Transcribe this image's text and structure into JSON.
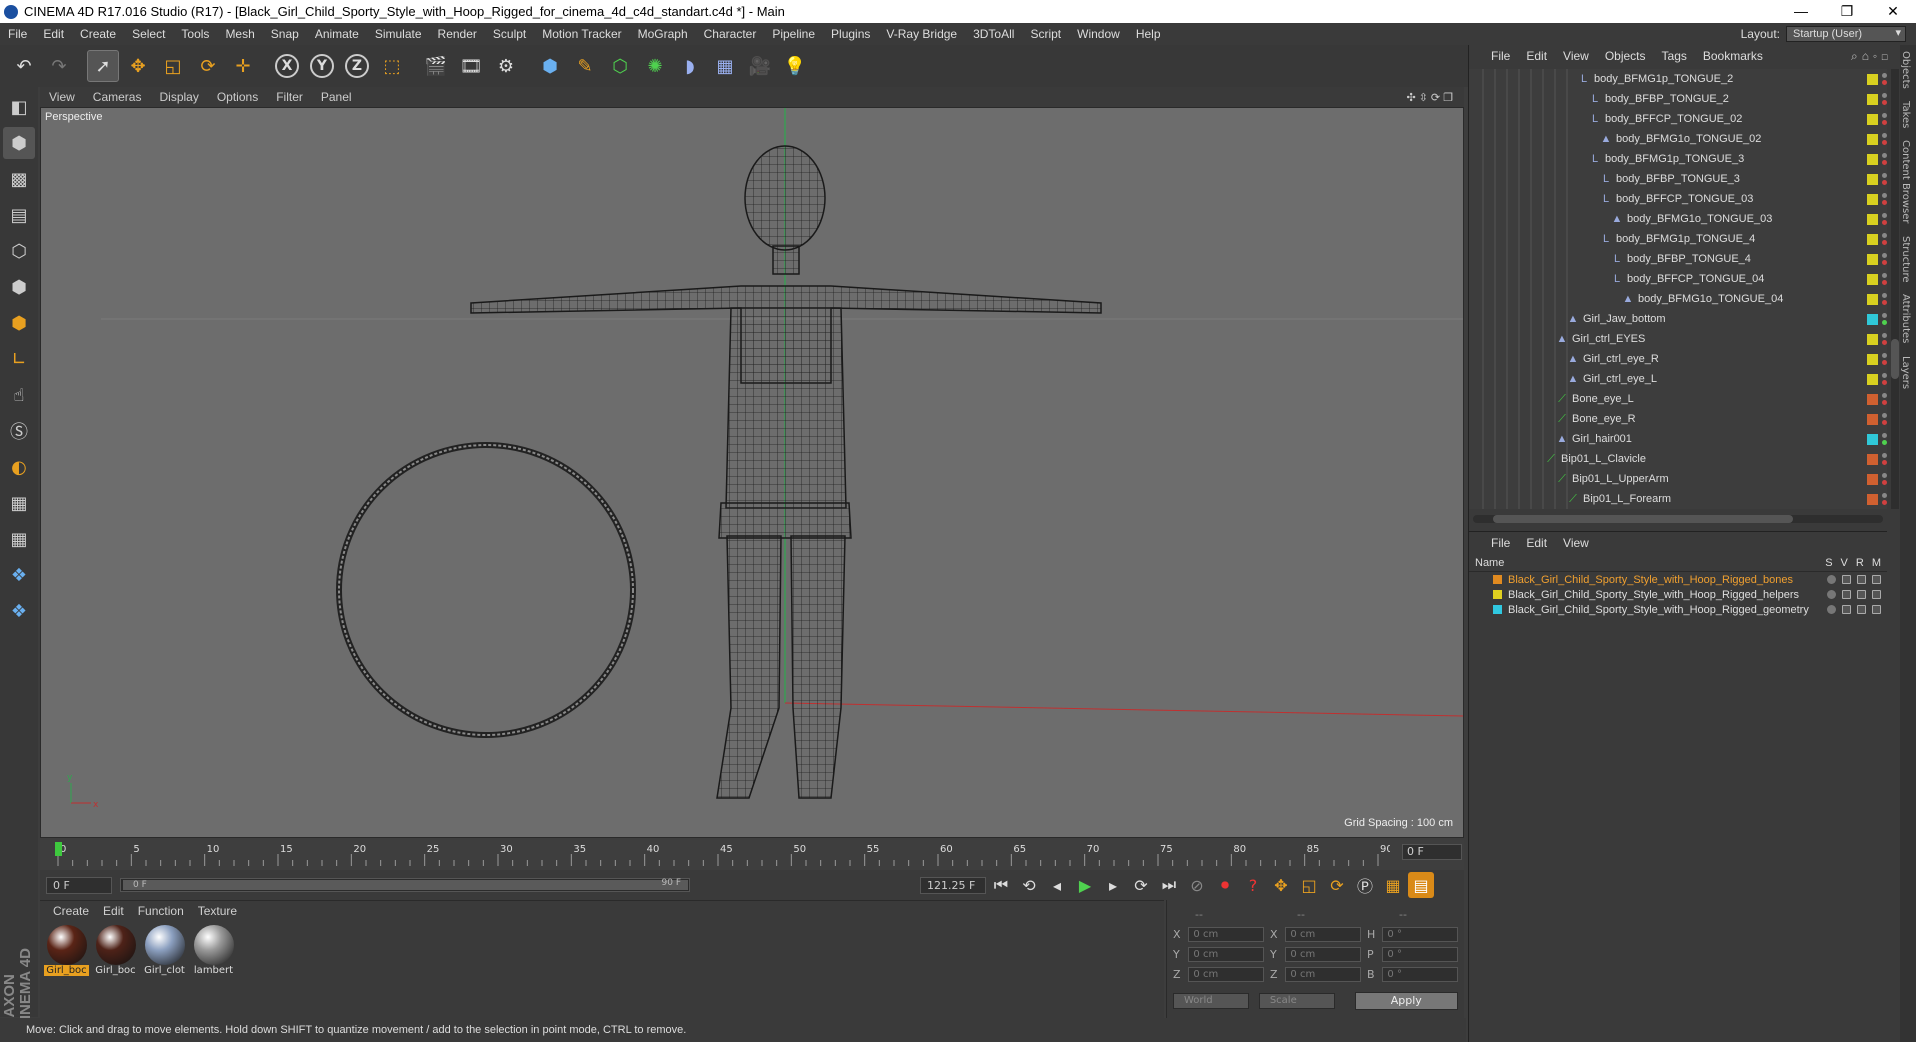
{
  "window": {
    "title": "CINEMA 4D R17.016 Studio (R17) - [Black_Girl_Child_Sporty_Style_with_Hoop_Rigged_for_cinema_4d_c4d_standart.c4d *] - Main",
    "min": "—",
    "restore": "❐",
    "close": "✕"
  },
  "menubar": {
    "items": [
      "File",
      "Edit",
      "Create",
      "Select",
      "Tools",
      "Mesh",
      "Snap",
      "Animate",
      "Simulate",
      "Render",
      "Sculpt",
      "Motion Tracker",
      "MoGraph",
      "Character",
      "Pipeline",
      "Plugins",
      "V-Ray Bridge",
      "3DToAll",
      "Script",
      "Window",
      "Help"
    ],
    "layout_label": "Layout:",
    "layout_value": "Startup (User)"
  },
  "toolbar": {
    "axis_x": "X",
    "axis_y": "Y",
    "axis_z": "Z"
  },
  "viewport": {
    "menu": [
      "View",
      "Cameras",
      "Display",
      "Options",
      "Filter",
      "Panel"
    ],
    "nav_icons": "✣⇳⟳❐",
    "label": "Perspective",
    "grid_spacing": "Grid Spacing : 100 cm",
    "axis_x": "x",
    "axis_y": "y"
  },
  "timeline": {
    "ticks": [
      "0",
      "5",
      "10",
      "15",
      "20",
      "25",
      "30",
      "35",
      "40",
      "45",
      "50",
      "55",
      "60",
      "65",
      "70",
      "75",
      "80",
      "85",
      "90"
    ],
    "current_frame": "0 F"
  },
  "transport": {
    "start_field": "0 F",
    "range_start": "0 F",
    "range_end": "90 F",
    "end_field": "121.25 F"
  },
  "materials": {
    "menu": [
      "Create",
      "Edit",
      "Function",
      "Texture"
    ],
    "items": [
      {
        "label": "Girl_boc",
        "color": "#5a2416"
      },
      {
        "label": "Girl_boc",
        "color": "#4e2218"
      },
      {
        "label": "Girl_clot",
        "color": "#8ca0c0"
      },
      {
        "label": "lambert",
        "color": "#9a9a9a"
      }
    ]
  },
  "coords": {
    "header": [
      "--",
      "--",
      "--"
    ],
    "rows": [
      {
        "a": "X",
        "av": "0 cm",
        "b": "X",
        "bv": "0 cm",
        "c": "H",
        "cv": "0 °"
      },
      {
        "a": "Y",
        "av": "0 cm",
        "b": "Y",
        "bv": "0 cm",
        "c": "P",
        "cv": "0 °"
      },
      {
        "a": "Z",
        "av": "0 cm",
        "b": "Z",
        "bv": "0 cm",
        "c": "B",
        "cv": "0 °"
      }
    ],
    "world": "World",
    "scale": "Scale",
    "apply": "Apply"
  },
  "status": {
    "text": "Move: Click and drag to move elements. Hold down SHIFT to quantize movement / add to the selection in point mode, CTRL to remove."
  },
  "objects": {
    "menu": [
      "File",
      "Edit",
      "View",
      "Objects",
      "Tags",
      "Bookmarks"
    ],
    "rows": [
      {
        "name": "body_BFMG1p_TONGUE_2",
        "depth": 9,
        "icon": "null",
        "color": "#d8d020"
      },
      {
        "name": "body_BFBP_TONGUE_2",
        "depth": 10,
        "icon": "null",
        "color": "#d8d020"
      },
      {
        "name": "body_BFFCP_TONGUE_02",
        "depth": 10,
        "icon": "null",
        "color": "#d8d020"
      },
      {
        "name": "body_BFMG1o_TONGUE_02",
        "depth": 11,
        "icon": "joint",
        "color": "#d8d020"
      },
      {
        "name": "body_BFMG1p_TONGUE_3",
        "depth": 10,
        "icon": "null",
        "color": "#d8d020"
      },
      {
        "name": "body_BFBP_TONGUE_3",
        "depth": 11,
        "icon": "null",
        "color": "#d8d020"
      },
      {
        "name": "body_BFFCP_TONGUE_03",
        "depth": 11,
        "icon": "null",
        "color": "#d8d020"
      },
      {
        "name": "body_BFMG1o_TONGUE_03",
        "depth": 12,
        "icon": "joint",
        "color": "#d8d020"
      },
      {
        "name": "body_BFMG1p_TONGUE_4",
        "depth": 11,
        "icon": "null",
        "color": "#d8d020"
      },
      {
        "name": "body_BFBP_TONGUE_4",
        "depth": 12,
        "icon": "null",
        "color": "#d8d020"
      },
      {
        "name": "body_BFFCP_TONGUE_04",
        "depth": 12,
        "icon": "null",
        "color": "#d8d020"
      },
      {
        "name": "body_BFMG1o_TONGUE_04",
        "depth": 13,
        "icon": "joint",
        "color": "#d8d020"
      },
      {
        "name": "Girl_Jaw_bottom",
        "depth": 8,
        "icon": "joint",
        "color": "#30c8d8"
      },
      {
        "name": "Girl_ctrl_EYES",
        "depth": 7,
        "icon": "joint",
        "color": "#d8d020"
      },
      {
        "name": "Girl_ctrl_eye_R",
        "depth": 8,
        "icon": "joint",
        "color": "#d8d020"
      },
      {
        "name": "Girl_ctrl_eye_L",
        "depth": 8,
        "icon": "joint",
        "color": "#d8d020"
      },
      {
        "name": "Bone_eye_L",
        "depth": 7,
        "icon": "bone",
        "color": "#d06030"
      },
      {
        "name": "Bone_eye_R",
        "depth": 7,
        "icon": "bone",
        "color": "#d06030"
      },
      {
        "name": "Girl_hair001",
        "depth": 7,
        "icon": "joint",
        "color": "#30c8d8"
      },
      {
        "name": "Bip01_L_Clavicle",
        "depth": 6,
        "icon": "bone",
        "color": "#d06030"
      },
      {
        "name": "Bip01_L_UpperArm",
        "depth": 7,
        "icon": "bone",
        "color": "#d06030"
      },
      {
        "name": "Bip01_L_Forearm",
        "depth": 8,
        "icon": "bone",
        "color": "#d06030"
      }
    ]
  },
  "layers": {
    "menu": [
      "File",
      "Edit",
      "View"
    ],
    "head_name": "Name",
    "cols": [
      "S",
      "V",
      "R",
      "M"
    ],
    "rows": [
      {
        "name": "Black_Girl_Child_Sporty_Style_with_Hoop_Rigged_bones",
        "color": "#e08a20",
        "text_color": "#f0a030"
      },
      {
        "name": "Black_Girl_Child_Sporty_Style_with_Hoop_Rigged_helpers",
        "color": "#e0d020",
        "text_color": "#dddddd"
      },
      {
        "name": "Black_Girl_Child_Sporty_Style_with_Hoop_Rigged_geometry",
        "color": "#30c8e0",
        "text_color": "#dddddd"
      }
    ]
  },
  "sidetabs": [
    "Objects",
    "Takes",
    "Content Browser",
    "Structure",
    "Attributes",
    "Layers"
  ]
}
